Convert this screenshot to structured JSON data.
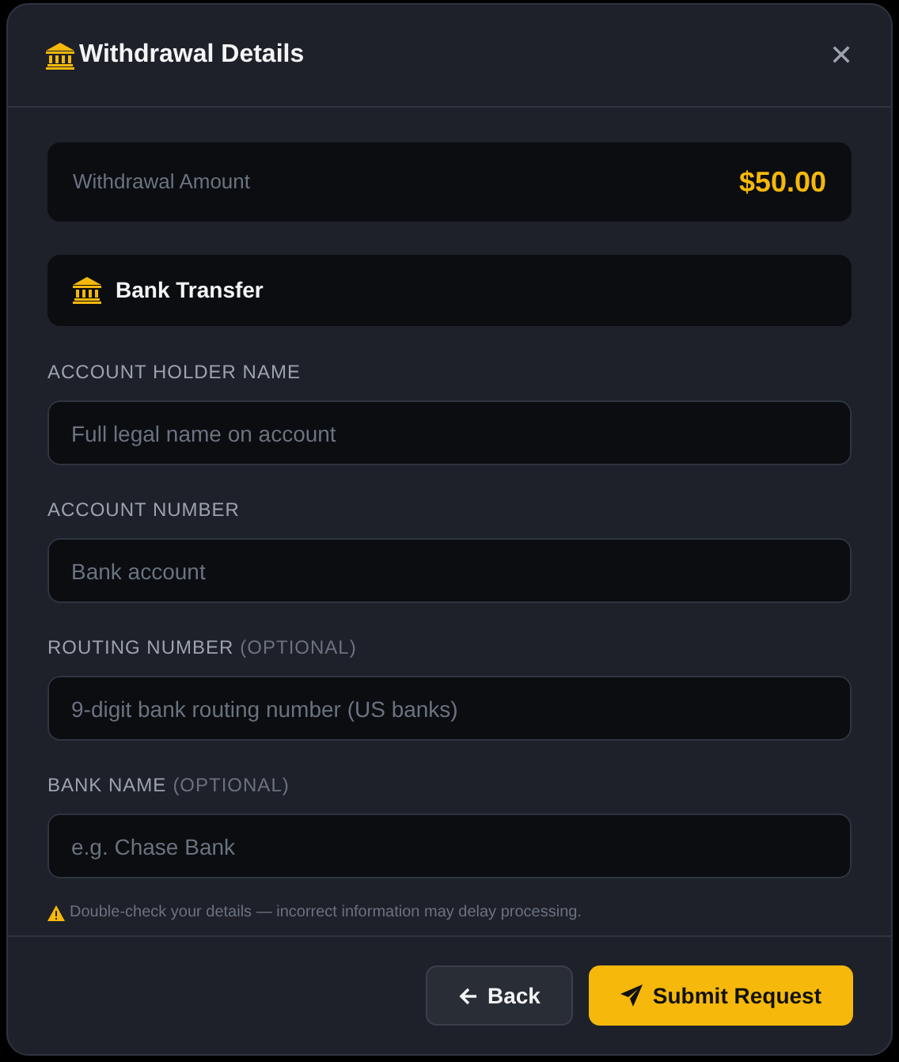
{
  "dialog": {
    "title": "Withdrawal Details",
    "close": "✕"
  },
  "amount": {
    "label": "Withdrawal Amount",
    "value": "$50.00"
  },
  "method": {
    "label": "Bank Transfer"
  },
  "fields": [
    {
      "label": "ACCOUNT HOLDER NAME",
      "placeholder": "Full legal name on account"
    },
    {
      "label": "ACCOUNT NUMBER",
      "placeholder": "Bank account"
    },
    {
      "label": "ROUTING NUMBER",
      "note": "(OPTIONAL)",
      "placeholder": "9-digit bank routing number (US banks)"
    },
    {
      "label": "BANK NAME",
      "note": "(OPTIONAL)",
      "placeholder": "e.g. Chase Bank"
    }
  ],
  "warning": "Double-check your details — incorrect information may delay processing.",
  "buttons": [
    {
      "kind": "secondary",
      "label": "Back"
    },
    {
      "kind": "primary",
      "label": "Submit Request"
    }
  ]
}
